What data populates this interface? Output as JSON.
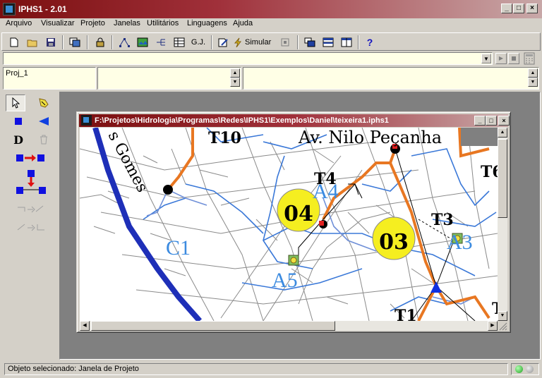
{
  "app": {
    "title": "IPHS1 - 2.01"
  },
  "title_buttons": {
    "minimize": "_",
    "maximize": "□",
    "close": "×"
  },
  "menu": [
    "Arquivo",
    "Visualizar",
    "Projeto",
    "Janelas",
    "Utilitários",
    "Linguagens",
    "Ajuda"
  ],
  "toolbar": {
    "gj_label": "G.J.",
    "simulate_label": "Simular",
    "help_label": "?"
  },
  "panels": {
    "project_name": "Proj_1"
  },
  "child_window": {
    "title": "F:\\Projetos\\Hidrologia\\Programas\\Redes\\IPHS1\\Exemplos\\Daniel\\teixeira1.iphs1"
  },
  "map": {
    "street_label_1": "s Gomes",
    "street_label_2": "Av. Nilo Peçanha",
    "nodes": [
      {
        "label": "T10"
      },
      {
        "label": "T4"
      },
      {
        "label": "T3"
      },
      {
        "label": "T6"
      },
      {
        "label": "T1"
      },
      {
        "label": "T"
      }
    ],
    "subbasins": [
      {
        "label": "A4"
      },
      {
        "label": "A3"
      },
      {
        "label": "A5"
      },
      {
        "label": "C1"
      }
    ],
    "circles": [
      {
        "label": "04"
      },
      {
        "label": "03"
      }
    ],
    "colors": {
      "river": "#1e2fb8",
      "streets": "#8a8a8a",
      "channels": "#e87722",
      "basin_border": "#3a78d8",
      "circle_fill": "#f5ee20",
      "label_blue": "#3c8be0"
    }
  },
  "status": {
    "text": "Objeto selecionado: Janela de Projeto"
  }
}
